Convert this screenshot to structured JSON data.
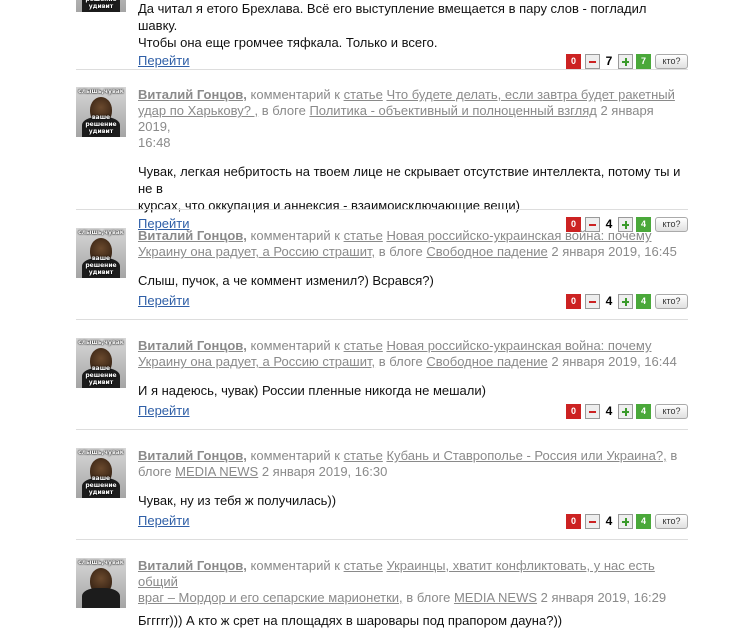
{
  "page": {
    "goto_label": "Перейти"
  },
  "avatar_caption": {
    "top": "слышь,чувак",
    "bottom": "ваше решение удивит"
  },
  "comments": [
    {
      "lines": [
        "Да читал я етого Брехлава. Всё его выступление вмещается в пару слов - погладил шавку.",
        "Чтобы она еще громчее тяфкала. Только и всего."
      ],
      "votes": {
        "minus": "0",
        "score": "7",
        "plus": "7",
        "who": "кто?"
      }
    },
    {
      "author": "Виталий Гонцов,",
      "m1": "комментарий к",
      "m2": "статье",
      "title_l1": "Что будете делать, если завтра будет ракетный",
      "title_l2": "удар по Харькову? ,",
      "m3": "в блоге",
      "blog": "Политика - объективный и полноценный взгляд",
      "date_a": "2 января 2019,",
      "date_b": "16:48",
      "lines": [
        "Чувак, легкая небритость на твоем лице не скрывает отсутствие интеллекта, потому ты и не в",
        "курсах, что оккупация и аннексия - взаимоисключающие вещи)"
      ],
      "votes": {
        "minus": "0",
        "score": "4",
        "plus": "4",
        "who": "кто?"
      }
    },
    {
      "author": "Виталий Гонцов,",
      "m1": "комментарий к",
      "m2": "статье",
      "title_l1": "Новая российско-украинская война: почему",
      "title_l2": "Украину она радует, а Россию страшит,",
      "m3": "в блоге",
      "blog": "Свободное падение",
      "date": "2 января 2019, 16:45",
      "lines": [
        "Слыш, пучок, а че коммент изменил?) Всрався?)"
      ],
      "votes": {
        "minus": "0",
        "score": "4",
        "plus": "4",
        "who": "кто?"
      }
    },
    {
      "author": "Виталий Гонцов,",
      "m1": "комментарий к",
      "m2": "статье",
      "title_l1": "Новая российско-украинская война: почему",
      "title_l2": "Украину она радует, а Россию страшит,",
      "m3": "в блоге",
      "blog": "Свободное падение",
      "date": "2 января 2019, 16:44",
      "lines": [
        "И я надеюсь, чувак) России пленные никогда не мешали)"
      ],
      "votes": {
        "minus": "0",
        "score": "4",
        "plus": "4",
        "who": "кто?"
      }
    },
    {
      "author": "Виталий Гонцов,",
      "m1": "комментарий к",
      "m2": "статье",
      "title": "Кубань и Ставрополье - Россия или Украина?,",
      "m3": "в",
      "m3b": "блоге",
      "blog": "MEDIA NEWS",
      "date": "2 января 2019, 16:30",
      "lines": [
        "Чувак, ну из тебя ж получилась))"
      ],
      "votes": {
        "minus": "0",
        "score": "4",
        "plus": "4",
        "who": "кто?"
      }
    },
    {
      "author": "Виталий Гонцов,",
      "m1": "комментарий к",
      "m2": "статье",
      "title_l1": "Украинцы, хватит конфликтовать, у нас есть общий",
      "title_l2": "враг – Мордор и его сепарские марионетки,",
      "m3": "в блоге",
      "blog": "MEDIA NEWS",
      "date": "2 января 2019, 16:29",
      "lines": [
        "Бгггrr))) А кто ж срет на площадях в шаровары под прапором дауна?))"
      ]
    }
  ]
}
